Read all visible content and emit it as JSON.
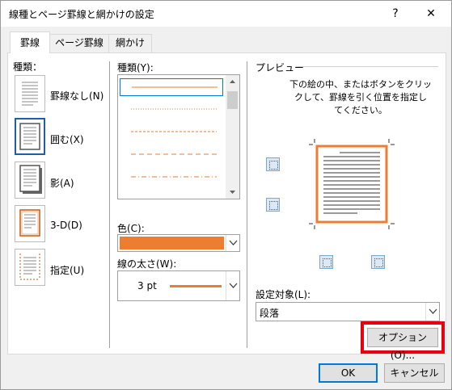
{
  "window": {
    "title": "線種とページ罫線と網かけの設定",
    "help_label": "?",
    "close_label": "✕"
  },
  "tabs": [
    {
      "label": "罫線",
      "active": true
    },
    {
      "label": "ページ罫線",
      "active": false
    },
    {
      "label": "網かけ",
      "active": false
    }
  ],
  "settings": {
    "label": "種類：",
    "items": [
      {
        "label": "罫線なし(N)",
        "selected": false
      },
      {
        "label": "囲む(X)",
        "selected": true
      },
      {
        "label": "影(A)",
        "selected": false
      },
      {
        "label": "3-D(D)",
        "selected": false
      },
      {
        "label": "指定(U)",
        "selected": false
      }
    ]
  },
  "style": {
    "label": "種類(Y):",
    "items": [
      "solid",
      "dotted",
      "dash-small",
      "dash-large",
      "dash-dot"
    ],
    "selected_index": 0
  },
  "color": {
    "label": "色(C):",
    "value": "#ed7d31"
  },
  "width": {
    "label": "線の太さ(W):",
    "value": "3 pt"
  },
  "preview": {
    "label": "プレビュー",
    "instruction": "下の絵の中、またはボタンをクリックして、罫線を引く位置を指定してください。",
    "instruction_lines": [
      "下の絵の中、またはボタンをクリッ",
      "クして、罫線を引く位置を指定し",
      "てください。"
    ],
    "border_color": "#ed7d31"
  },
  "apply_to": {
    "label": "設定対象(L):",
    "value": "段落"
  },
  "options_button": "オプション(O)...",
  "ok_button": "OK",
  "cancel_button": "キャンセル",
  "accent": {
    "highlight": "#e60012",
    "line": "#ed7d31",
    "focus": "#0078d7"
  }
}
